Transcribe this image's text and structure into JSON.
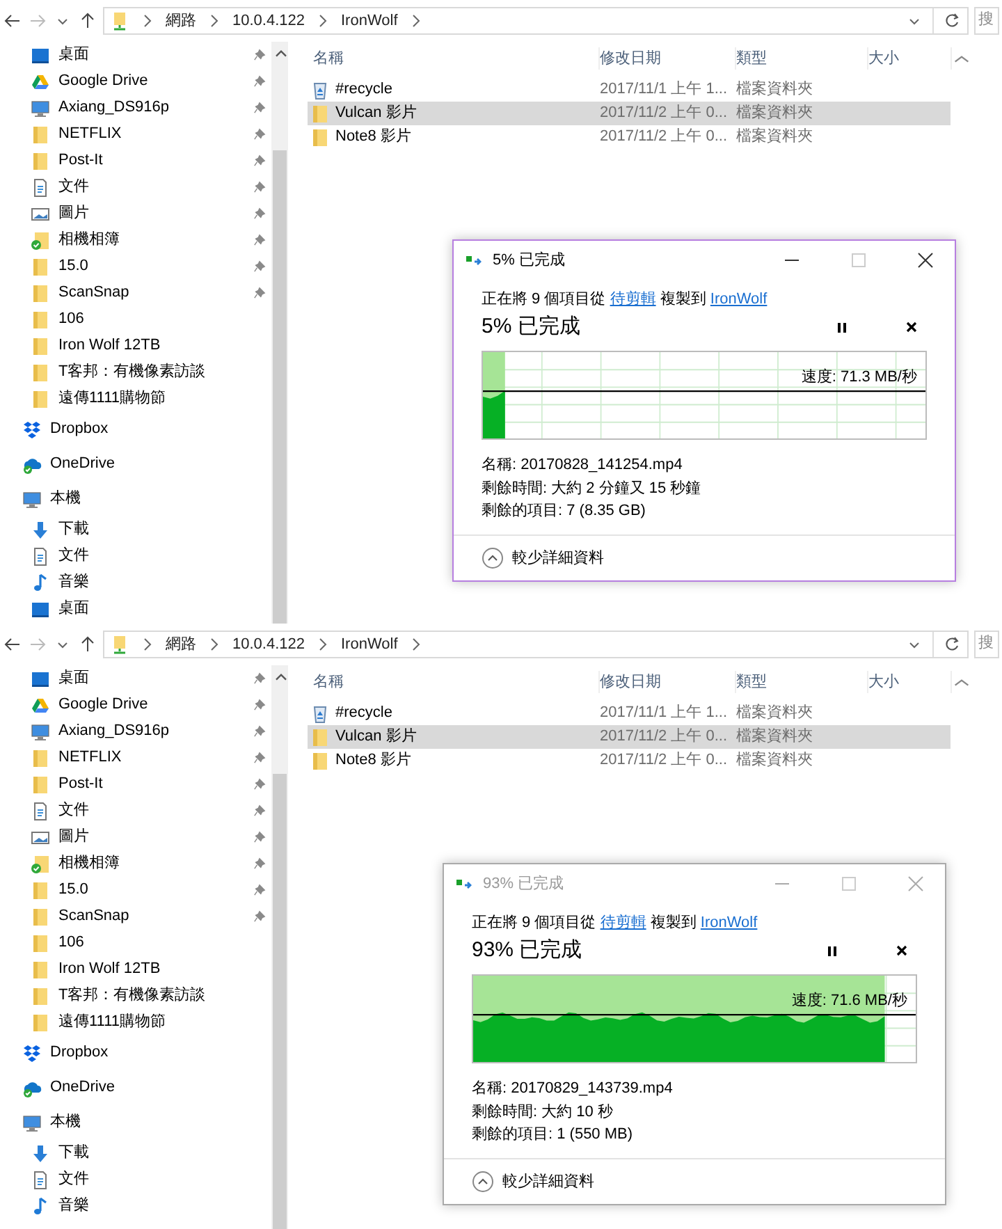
{
  "screens": [
    {
      "address": {
        "crumbs": [
          "網路",
          "10.0.4.122",
          "IronWolf"
        ],
        "search_placeholder": "搜"
      },
      "quick_access": [
        {
          "label": "桌面",
          "kind": "desktop",
          "pinned": true
        },
        {
          "label": "Google Drive",
          "kind": "drive",
          "pinned": true
        },
        {
          "label": "Axiang_DS916p",
          "kind": "monitor",
          "pinned": true
        },
        {
          "label": "NETFLIX",
          "kind": "folder",
          "pinned": true
        },
        {
          "label": "Post-It",
          "kind": "folder",
          "pinned": true
        },
        {
          "label": "文件",
          "kind": "document",
          "pinned": true
        },
        {
          "label": "圖片",
          "kind": "pictures",
          "pinned": true
        },
        {
          "label": "相機相簿",
          "kind": "synced-folder",
          "pinned": true
        },
        {
          "label": "15.0",
          "kind": "folder",
          "pinned": true
        },
        {
          "label": "ScanSnap",
          "kind": "folder",
          "pinned": true
        },
        {
          "label": "106",
          "kind": "folder",
          "pinned": false
        },
        {
          "label": "Iron Wolf 12TB",
          "kind": "folder",
          "pinned": false
        },
        {
          "label": "T客邦：有機像素訪談",
          "kind": "folder",
          "pinned": false
        },
        {
          "label": "遠傳1111購物節",
          "kind": "folder",
          "pinned": false
        }
      ],
      "places": [
        {
          "label": "Dropbox",
          "kind": "dropbox"
        },
        {
          "label": "OneDrive",
          "kind": "cloud"
        },
        {
          "label": "本機",
          "kind": "monitor",
          "children": [
            {
              "label": "下載",
              "kind": "download"
            },
            {
              "label": "文件",
              "kind": "document"
            },
            {
              "label": "音樂",
              "kind": "music"
            },
            {
              "label": "桌面",
              "kind": "desktop"
            }
          ]
        }
      ],
      "columns": [
        "名稱",
        "修改日期",
        "類型",
        "大小"
      ],
      "files": [
        {
          "name": "#recycle",
          "kind": "recycle",
          "modified": "2017/11/1 上午 1...",
          "type": "檔案資料夾",
          "selected": false
        },
        {
          "name": "Vulcan 影片",
          "kind": "folder",
          "modified": "2017/11/2 上午 0...",
          "type": "檔案資料夾",
          "selected": true
        },
        {
          "name": "Note8 影片",
          "kind": "folder",
          "modified": "2017/11/2 上午 0...",
          "type": "檔案資料夾",
          "selected": false
        }
      ],
      "dialog": {
        "title": "5% 已完成",
        "active": true,
        "prefix": "正在將 9 個項目從",
        "source": "待剪輯",
        "middle": "複製到",
        "destination": "IronWolf",
        "status": "5% 已完成",
        "level": 0.05,
        "speed": "速度: 71.3 MB/秒",
        "details": [
          "名稱: 20170828_141254.mp4",
          "剩餘時間: 大約 2 分鐘又 15 秒鐘",
          "剩餘的項目: 7 (8.35 GB)"
        ],
        "toggle": "較少詳細資料"
      }
    },
    {
      "address": {
        "crumbs": [
          "網路",
          "10.0.4.122",
          "IronWolf"
        ],
        "search_placeholder": "搜"
      },
      "quick_access": [
        {
          "label": "桌面",
          "kind": "desktop",
          "pinned": true
        },
        {
          "label": "Google Drive",
          "kind": "drive",
          "pinned": true
        },
        {
          "label": "Axiang_DS916p",
          "kind": "monitor",
          "pinned": true
        },
        {
          "label": "NETFLIX",
          "kind": "folder",
          "pinned": true
        },
        {
          "label": "Post-It",
          "kind": "folder",
          "pinned": true
        },
        {
          "label": "文件",
          "kind": "document",
          "pinned": true
        },
        {
          "label": "圖片",
          "kind": "pictures",
          "pinned": true
        },
        {
          "label": "相機相簿",
          "kind": "synced-folder",
          "pinned": true
        },
        {
          "label": "15.0",
          "kind": "folder",
          "pinned": true
        },
        {
          "label": "ScanSnap",
          "kind": "folder",
          "pinned": true
        },
        {
          "label": "106",
          "kind": "folder",
          "pinned": false
        },
        {
          "label": "Iron Wolf 12TB",
          "kind": "folder",
          "pinned": false
        },
        {
          "label": "T客邦：有機像素訪談",
          "kind": "folder",
          "pinned": false
        },
        {
          "label": "遠傳1111購物節",
          "kind": "folder",
          "pinned": false
        }
      ],
      "places": [
        {
          "label": "Dropbox",
          "kind": "dropbox"
        },
        {
          "label": "OneDrive",
          "kind": "cloud"
        },
        {
          "label": "本機",
          "kind": "monitor",
          "children": [
            {
              "label": "下載",
              "kind": "download"
            },
            {
              "label": "文件",
              "kind": "document"
            },
            {
              "label": "音樂",
              "kind": "music"
            }
          ]
        }
      ],
      "columns": [
        "名稱",
        "修改日期",
        "類型",
        "大小"
      ],
      "files": [
        {
          "name": "#recycle",
          "kind": "recycle",
          "modified": "2017/11/1 上午 1...",
          "type": "檔案資料夾",
          "selected": false
        },
        {
          "name": "Vulcan 影片",
          "kind": "folder",
          "modified": "2017/11/2 上午 0...",
          "type": "檔案資料夾",
          "selected": true
        },
        {
          "name": "Note8 影片",
          "kind": "folder",
          "modified": "2017/11/2 上午 0...",
          "type": "檔案資料夾",
          "selected": false
        }
      ],
      "dialog": {
        "title": "93% 已完成",
        "active": false,
        "prefix": "正在將 9 個項目從",
        "source": "待剪輯",
        "middle": "複製到",
        "destination": "IronWolf",
        "status": "93% 已完成",
        "level": 0.93,
        "speed": "速度: 71.6 MB/秒",
        "details": [
          "名稱: 20170829_143739.mp4",
          "剩餘時間: 大約 10 秒",
          "剩餘的項目: 1 (550 MB)"
        ],
        "toggle": "較少詳細資料"
      }
    }
  ]
}
